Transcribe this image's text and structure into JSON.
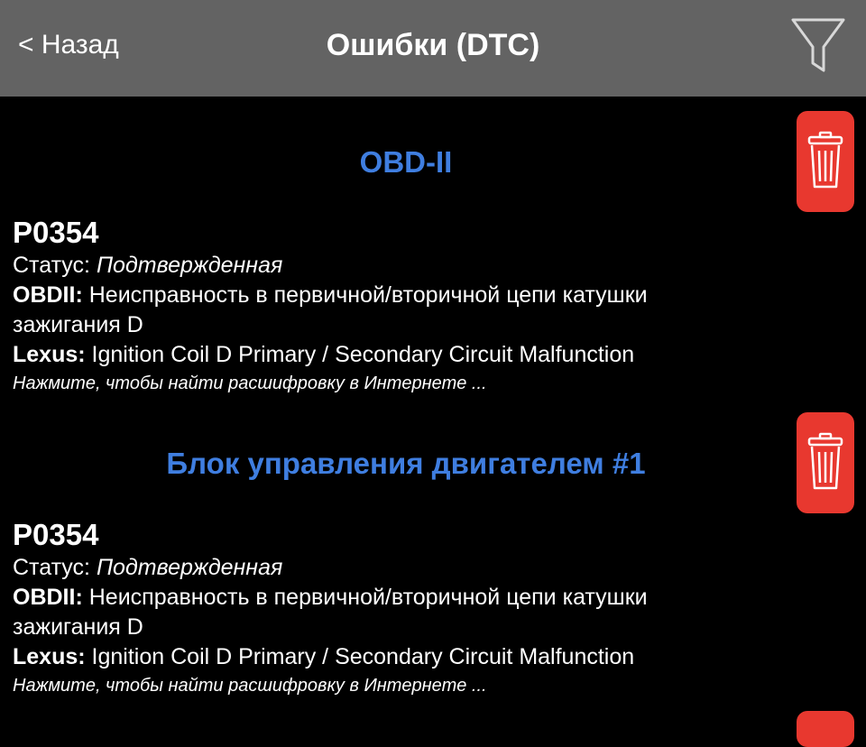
{
  "nav": {
    "back_label": "< Назад",
    "title": "Ошибки (DTC)",
    "filter_icon": "filter-funnel-icon"
  },
  "colors": {
    "nav_bg": "#636363",
    "accent_blue": "#3f7ee0",
    "delete_red": "#e8382f",
    "background": "#000000"
  },
  "sections": [
    {
      "title": "OBD-II",
      "delete_icon": "trash-icon",
      "item": {
        "code": "P0354",
        "status_label": "Статус:",
        "status_value": "Подтвержденная",
        "obd_label": "OBDII:",
        "obd_text_line1": "Неисправность в первичной/вторичной цепи катушки",
        "obd_text_line2": "зажигания D",
        "maker_label": "Lexus:",
        "maker_text": "Ignition Coil D Primary / Secondary Circuit Malfunction",
        "hint": "Нажмите, чтобы найти расшифровку в Интернете ..."
      }
    },
    {
      "title": "Блок управления двигателем #1",
      "delete_icon": "trash-icon",
      "item": {
        "code": "P0354",
        "status_label": "Статус:",
        "status_value": "Подтвержденная",
        "obd_label": "OBDII:",
        "obd_text_line1": "Неисправность в первичной/вторичной цепи катушки",
        "obd_text_line2": "зажигания D",
        "maker_label": "Lexus:",
        "maker_text": "Ignition Coil D Primary / Secondary Circuit Malfunction",
        "hint": "Нажмите, чтобы найти расшифровку в Интернете ..."
      }
    }
  ]
}
